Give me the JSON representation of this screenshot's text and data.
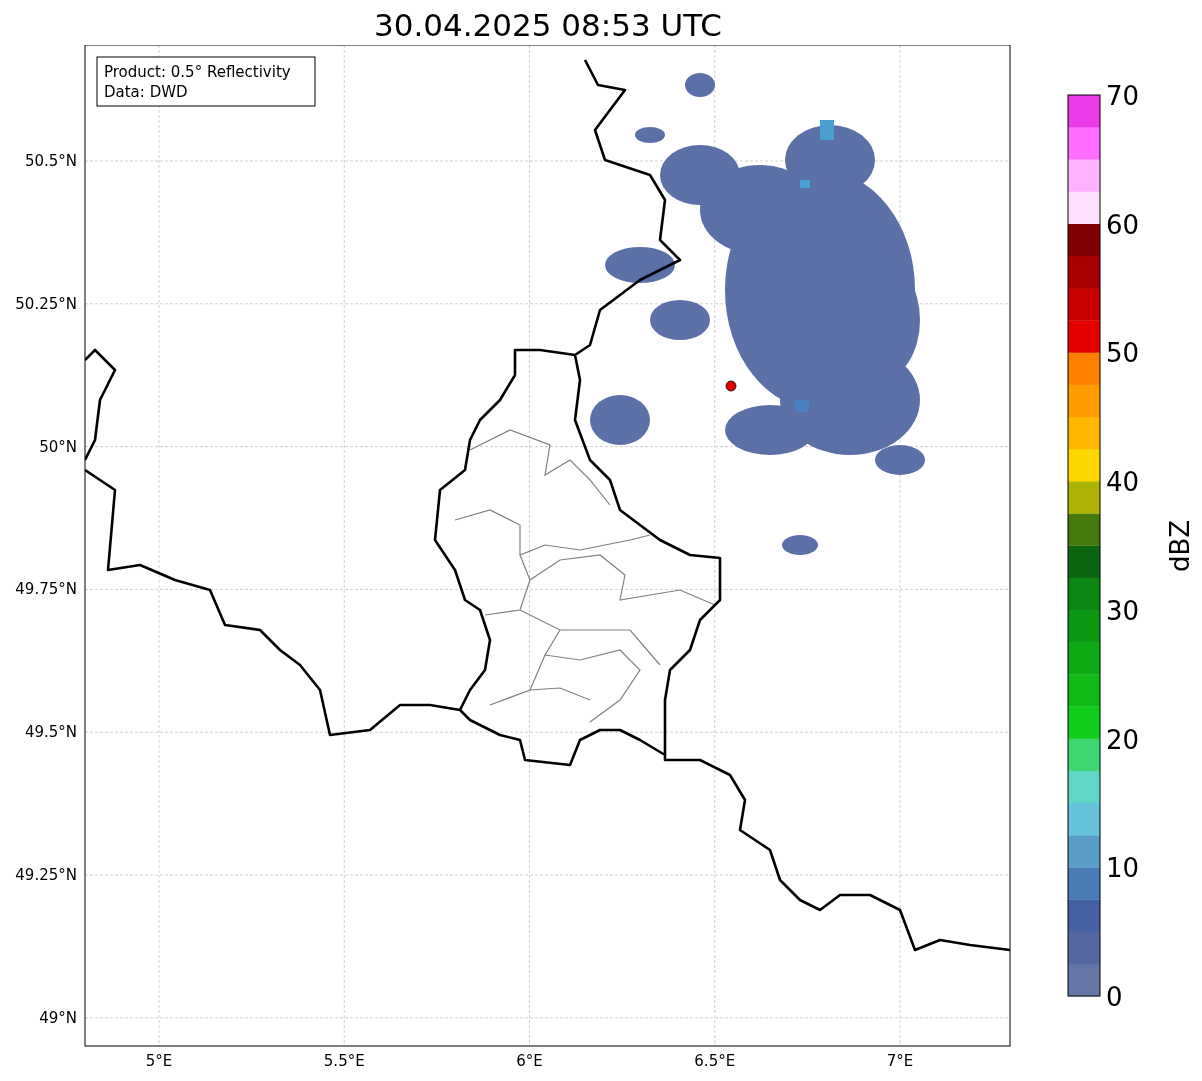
{
  "title": "30.04.2025 08:53 UTC",
  "legend": [
    "Product: 0.5° Reflectivity",
    "Data: DWD"
  ],
  "map": {
    "x_ticks": [
      "5°E",
      "5.5°E",
      "6°E",
      "6.5°E",
      "7°E"
    ],
    "y_ticks": [
      "50.5°N",
      "50.25°N",
      "50°N",
      "49.75°N",
      "49.5°N",
      "49.25°N",
      "49°N"
    ]
  },
  "colorbar": {
    "label": "dBZ",
    "ticks": [
      "70",
      "60",
      "50",
      "40",
      "30",
      "20",
      "10",
      "0"
    ],
    "bins": [
      {
        "color": "#6475a8"
      },
      {
        "color": "#54689f"
      },
      {
        "color": "#4560a3"
      },
      {
        "color": "#4b7bb5"
      },
      {
        "color": "#5a9ec8"
      },
      {
        "color": "#67c2dc"
      },
      {
        "color": "#5fd7c4"
      },
      {
        "color": "#3ed670"
      },
      {
        "color": "#11cc1b"
      },
      {
        "color": "#10bb18"
      },
      {
        "color": "#0fa916"
      },
      {
        "color": "#0d9813"
      },
      {
        "color": "#0b8612"
      },
      {
        "color": "#0b6410"
      },
      {
        "color": "#477a0e"
      },
      {
        "color": "#adb304"
      },
      {
        "color": "#ffd700"
      },
      {
        "color": "#ffb700"
      },
      {
        "color": "#ff9d00"
      },
      {
        "color": "#ff7f00"
      },
      {
        "color": "#e50000"
      },
      {
        "color": "#c80000"
      },
      {
        "color": "#a80000"
      },
      {
        "color": "#800000"
      },
      {
        "color": "#ffe0ff"
      },
      {
        "color": "#ffb3ff"
      },
      {
        "color": "#ff6cff"
      },
      {
        "color": "#eb3ae8"
      }
    ]
  }
}
